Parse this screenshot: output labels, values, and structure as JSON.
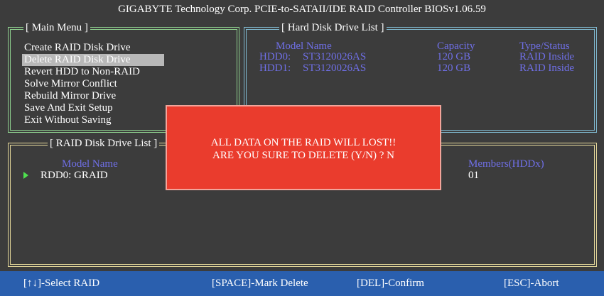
{
  "title": "GIGABYTE Technology Corp.  PCIE-to-SATAII/IDE RAID Controller BIOSv1.06.59",
  "main_menu": {
    "title": "[ Main Menu ]",
    "items": [
      "Create RAID Disk Drive",
      "Delete RAID Disk Drive",
      "Revert HDD to Non-RAID",
      "Solve Mirror Conflict",
      "Rebuild Mirror Drive",
      "Save And Exit Setup",
      "Exit Without Saving"
    ],
    "selected_index": 1
  },
  "hdd_list": {
    "title": "[ Hard Disk Drive List ]",
    "headers": {
      "model": "Model Name",
      "capacity": "Capacity",
      "type": "Type/Status"
    },
    "rows": [
      {
        "id": "HDD0:",
        "model": "ST3120026AS",
        "capacity": "120 GB",
        "type": "RAID Inside"
      },
      {
        "id": "HDD1:",
        "model": "ST3120026AS",
        "capacity": "120 GB",
        "type": "RAID Inside"
      }
    ]
  },
  "raid_list": {
    "title": "[ RAID Disk Drive List ]",
    "headers": {
      "model": "Model Name",
      "members": "Members(HDDx)"
    },
    "rows": [
      {
        "name": "RDD0: GRAID",
        "members": "01"
      }
    ]
  },
  "dialog": {
    "line1": "ALL DATA ON THE RAID WILL LOST!!",
    "line2": "ARE YOU SURE TO DELETE (Y/N) ? N"
  },
  "status_bar": {
    "select": "[↑↓]-Select RAID",
    "mark": "[SPACE]-Mark Delete",
    "confirm": "[DEL]-Confirm",
    "abort": "[ESC]-Abort"
  },
  "colors": {
    "background": "#3c3c3c",
    "header_text": "#6f6fe6",
    "dialog": "#ea3c2d",
    "status_bar": "#2a5fae",
    "selected_item": "#b8b8b8",
    "arrow": "#4ee04e"
  }
}
